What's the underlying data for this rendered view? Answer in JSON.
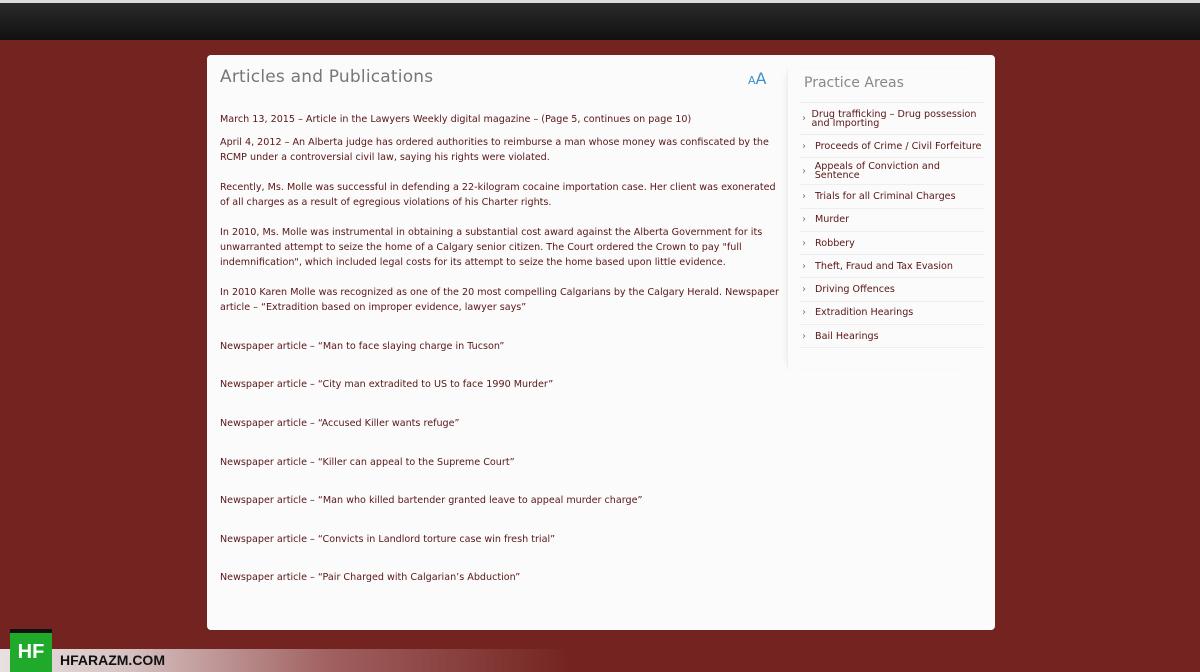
{
  "main": {
    "title": "Articles and Publications",
    "font_small": "A",
    "font_large": "A",
    "paragraphs": [
      "March 13, 2015 – Article in the Lawyers Weekly digital magazine – (Page 5, continues on page 10)",
      "April 4, 2012 – An Alberta judge has ordered authorities to reimburse a man whose money was confiscated by the RCMP under a controversial civil law, saying his rights were violated.",
      "Recently, Ms. Molle was successful in defending a 22-kilogram cocaine importation case. Her client was exonerated of all charges as a result of egregious violations of his Charter rights.",
      "In 2010, Ms. Molle was instrumental in obtaining a substantial cost award against the Alberta Government for its unwarranted attempt to seize the home of a Calgary senior citizen. The Court ordered the Crown to pay \"full indemnification\", which included legal costs for its attempt to seize the home based upon little evidence.",
      "In 2010 Karen Molle was recognized as one of the 20 most compelling Calgarians by the Calgary Herald. Newspaper article – “Extradition based on improper evidence, lawyer says”",
      "Newspaper article – “Man to face slaying charge in Tucson”",
      "Newspaper article – “City man extradited to US to face 1990 Murder”",
      "Newspaper article – “Accused Killer wants refuge”",
      "Newspaper article – “Killer can appeal to the Supreme Court”",
      "Newspaper article – “Man who killed bartender granted leave to appeal murder charge”",
      "Newspaper article – “Convicts in Landlord torture case win fresh trial”",
      "Newspaper article – “Pair Charged with Calgarian’s Abduction”"
    ]
  },
  "sidebar": {
    "title": "Practice Areas",
    "items": [
      "Drug trafficking – Drug possession and Importing",
      "Proceeds of Crime / Civil Forfeiture",
      "Appeals of Conviction and Sentence",
      "Trials for all Criminal Charges",
      "Murder",
      "Robbery",
      "Theft, Fraud and Tax Evasion",
      "Driving Offences",
      "Extradition Hearings",
      "Bail Hearings"
    ]
  },
  "watermark": {
    "logo": "HF",
    "site": "HFARAZM.COM"
  }
}
